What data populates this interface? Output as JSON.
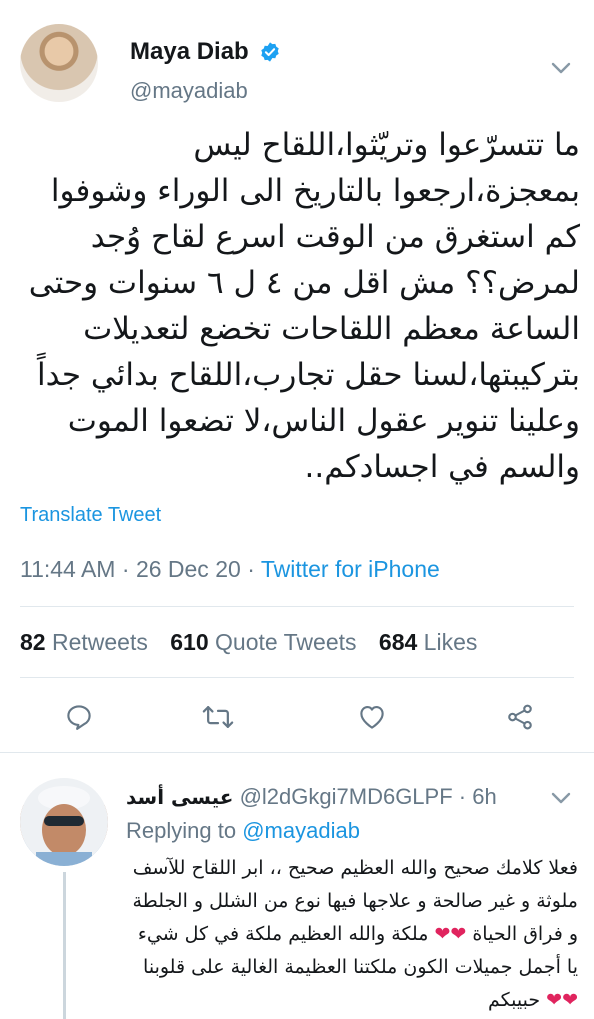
{
  "tweet": {
    "author_name": "Maya Diab",
    "handle": "@mayadiab",
    "text": "ما تتسرّعوا وتريّثوا،اللقاح ليس بمعجزة،ارجعوا بالتاريخ الى الوراء وشوفوا كم استغرق من الوقت اسرع لقاح وُجد لمرض؟؟ مش اقل من ٤ ل ٦ سنوات وحتى الساعة معظم اللقاحات تخضع لتعديلات بتركيبتها،لسنا حقل تجارب،اللقاح بدائي جداً وعلينا تنوير عقول الناس،لا تضعوا الموت والسم في اجسادكم..",
    "translate_label": "Translate Tweet",
    "time": "11:44 AM",
    "date": "26 Dec 20",
    "source": "Twitter for iPhone",
    "retweets_count": "82",
    "retweets_label": "Retweets",
    "quotes_count": "610",
    "quotes_label": "Quote Tweets",
    "likes_count": "684",
    "likes_label": "Likes"
  },
  "reply": {
    "author_name": "عيسى أسد",
    "handle": "@l2dGkgi7MD6GLPF",
    "age": "6h",
    "replying_label": "Replying to",
    "replying_to": "@mayadiab",
    "text_before_hearts_1": "فعلا كلامك صحيح والله العظيم صحيح ،، ابر اللقاح للآسف ملوثة و غير صالحة و علاجها فيها نوع من الشلل و الجلطة و فراق الحياة",
    "text_between_hearts": "ملكة والله العظيم ملكة في كل شيء يا أجمل جميلات الكون ملكتنا العظيمة الغالية على قلوبنا",
    "text_after_hearts_2": "حبيبكم"
  },
  "icons": {
    "verified": "verified-badge-icon",
    "more": "chevron-down-icon",
    "reply": "reply-bubble-icon",
    "retweet": "retweet-icon",
    "like": "heart-icon",
    "share": "share-icon"
  },
  "colors": {
    "link": "#1b95e0",
    "secondary_text": "#657786",
    "primary_text": "#14171a",
    "divider": "#e1e8ed",
    "heart_emoji": "#e0245e"
  }
}
